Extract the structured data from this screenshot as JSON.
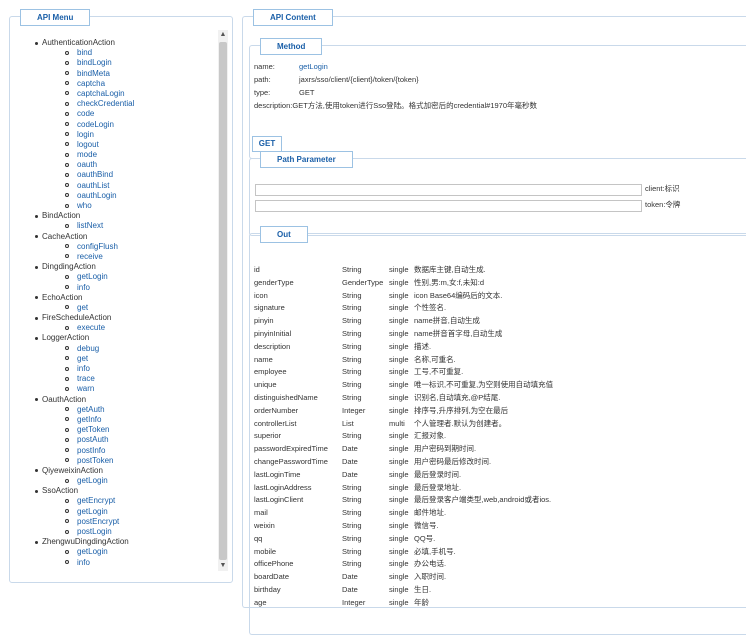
{
  "menu": {
    "title": "API Menu",
    "groups": [
      {
        "label": "AuthenticationAction",
        "items": [
          "bind",
          "bindLogin",
          "bindMeta",
          "captcha",
          "captchaLogin",
          "checkCredential",
          "code",
          "codeLogin",
          "login",
          "logout",
          "mode",
          "oauth",
          "oauthBind",
          "oauthList",
          "oauthLogin",
          "who"
        ]
      },
      {
        "label": "BindAction",
        "items": [
          "listNext"
        ]
      },
      {
        "label": "CacheAction",
        "items": [
          "configFlush",
          "receive"
        ]
      },
      {
        "label": "DingdingAction",
        "items": [
          "getLogin",
          "info"
        ]
      },
      {
        "label": "EchoAction",
        "items": [
          "get"
        ]
      },
      {
        "label": "FireScheduleAction",
        "items": [
          "execute"
        ]
      },
      {
        "label": "LoggerAction",
        "items": [
          "debug",
          "get",
          "info",
          "trace",
          "warn"
        ]
      },
      {
        "label": "OauthAction",
        "items": [
          "getAuth",
          "getInfo",
          "getToken",
          "postAuth",
          "postInfo",
          "postToken"
        ]
      },
      {
        "label": "QiyeweixinAction",
        "items": [
          "getLogin"
        ]
      },
      {
        "label": "SsoAction",
        "items": [
          "getEncrypt",
          "getLogin",
          "postEncrypt",
          "postLogin"
        ]
      },
      {
        "label": "ZhengwuDingdingAction",
        "items": [
          "getLogin",
          "info"
        ]
      }
    ]
  },
  "content": {
    "title": "API Content",
    "method": {
      "legend": "Method",
      "name_key": "name:",
      "name_value": "getLogin",
      "path_key": "path:",
      "path_value": "jaxrs/sso/client/{client}/token/{token}",
      "type_key": "type:",
      "type_value": "GET",
      "desc_key": "description:",
      "desc_value": "GET方法,使用token进行Sso登陆。格式加密后的credential#1970年毫秒数",
      "button_label": "GET"
    },
    "path_param": {
      "legend": "Path Parameter",
      "params": [
        {
          "label": "client:标识"
        },
        {
          "label": "token:令牌"
        }
      ]
    },
    "out": {
      "legend": "Out",
      "rows": [
        [
          "id",
          "String",
          "single",
          "数据库主键,自动生成."
        ],
        [
          "genderType",
          "GenderType",
          "single",
          "性别,男:m,女:f,未知:d"
        ],
        [
          "icon",
          "String",
          "single",
          "icon Base64编码后的文本."
        ],
        [
          "signature",
          "String",
          "single",
          "个性签名."
        ],
        [
          "pinyin",
          "String",
          "single",
          "name拼音,自动生成"
        ],
        [
          "pinyinInitial",
          "String",
          "single",
          "name拼音首字母,自动生成"
        ],
        [
          "description",
          "String",
          "single",
          "描述."
        ],
        [
          "name",
          "String",
          "single",
          "名称,可重名."
        ],
        [
          "employee",
          "String",
          "single",
          "工号,不可重复."
        ],
        [
          "unique",
          "String",
          "single",
          "唯一标识,不可重复,为空则使用自动填充值"
        ],
        [
          "distinguishedName",
          "String",
          "single",
          "识别名,自动填充,@P结尾."
        ],
        [
          "orderNumber",
          "Integer",
          "single",
          "排序号,升序排列,为空在最后"
        ],
        [
          "controllerList",
          "List",
          "multi",
          "个人管理者.默认为创建者。"
        ],
        [
          "superior",
          "String",
          "single",
          "汇报对象."
        ],
        [
          "passwordExpiredTime",
          "Date",
          "single",
          "用户密码到期时间."
        ],
        [
          "changePasswordTime",
          "Date",
          "single",
          "用户密码最后修改时间."
        ],
        [
          "lastLoginTime",
          "Date",
          "single",
          "最后登录时间."
        ],
        [
          "lastLoginAddress",
          "String",
          "single",
          "最后登录地址."
        ],
        [
          "lastLoginClient",
          "String",
          "single",
          "最后登录客户端类型,web,android或者ios."
        ],
        [
          "mail",
          "String",
          "single",
          "邮件地址."
        ],
        [
          "weixin",
          "String",
          "single",
          "微信号."
        ],
        [
          "qq",
          "String",
          "single",
          "QQ号."
        ],
        [
          "mobile",
          "String",
          "single",
          "必填,手机号."
        ],
        [
          "officePhone",
          "String",
          "single",
          "办公电话."
        ],
        [
          "boardDate",
          "Date",
          "single",
          "入职时间."
        ],
        [
          "birthday",
          "Date",
          "single",
          "生日."
        ],
        [
          "age",
          "Integer",
          "single",
          "年龄"
        ]
      ]
    }
  }
}
